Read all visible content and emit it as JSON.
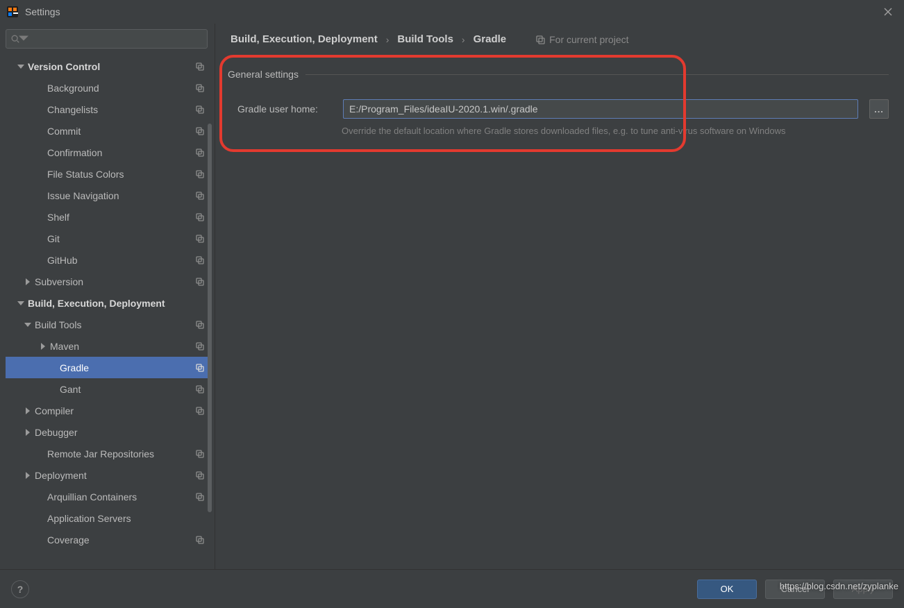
{
  "window": {
    "title": "Settings"
  },
  "search": {
    "placeholder": ""
  },
  "sidebar": {
    "items": [
      {
        "label": "Version Control",
        "indent": 0,
        "expanded": true,
        "bold": true,
        "badge": true
      },
      {
        "label": "Background",
        "indent": 2,
        "badge": true
      },
      {
        "label": "Changelists",
        "indent": 2,
        "badge": true
      },
      {
        "label": "Commit",
        "indent": 2,
        "badge": true
      },
      {
        "label": "Confirmation",
        "indent": 2,
        "badge": true
      },
      {
        "label": "File Status Colors",
        "indent": 2,
        "badge": true
      },
      {
        "label": "Issue Navigation",
        "indent": 2,
        "badge": true
      },
      {
        "label": "Shelf",
        "indent": 2,
        "badge": true
      },
      {
        "label": "Git",
        "indent": 2,
        "badge": true
      },
      {
        "label": "GitHub",
        "indent": 2,
        "badge": true
      },
      {
        "label": "Subversion",
        "indent": 1,
        "expanded": false,
        "hasChildren": true,
        "badge": true
      },
      {
        "label": "Build, Execution, Deployment",
        "indent": 0,
        "expanded": true,
        "bold": true
      },
      {
        "label": "Build Tools",
        "indent": 1,
        "expanded": true,
        "hasChildren": true,
        "badge": true
      },
      {
        "label": "Maven",
        "indent": 2,
        "expanded": false,
        "hasChildren": true,
        "badge": true
      },
      {
        "label": "Gradle",
        "indent": 3,
        "selected": true,
        "badge": true
      },
      {
        "label": "Gant",
        "indent": 3,
        "badge": true
      },
      {
        "label": "Compiler",
        "indent": 1,
        "expanded": false,
        "hasChildren": true,
        "badge": true
      },
      {
        "label": "Debugger",
        "indent": 1,
        "expanded": false,
        "hasChildren": true
      },
      {
        "label": "Remote Jar Repositories",
        "indent": 2,
        "badge": true
      },
      {
        "label": "Deployment",
        "indent": 1,
        "expanded": false,
        "hasChildren": true,
        "badge": true
      },
      {
        "label": "Arquillian Containers",
        "indent": 2,
        "badge": true
      },
      {
        "label": "Application Servers",
        "indent": 2
      },
      {
        "label": "Coverage",
        "indent": 2,
        "badge": true
      }
    ]
  },
  "breadcrumb": {
    "items": [
      "Build, Execution, Deployment",
      "Build Tools",
      "Gradle"
    ],
    "hint": "For current project"
  },
  "section": {
    "title": "General settings",
    "field_label": "Gradle user home:",
    "field_value": "E:/Program_Files/ideaIU-2020.1.win/.gradle",
    "browse_label": "...",
    "hint": "Override the default location where Gradle stores downloaded files, e.g. to tune anti-virus software on Windows"
  },
  "footer": {
    "ok": "OK",
    "cancel": "Cancel",
    "apply": "Apply",
    "help": "?"
  },
  "watermark": "https://blog.csdn.net/zyplanke"
}
